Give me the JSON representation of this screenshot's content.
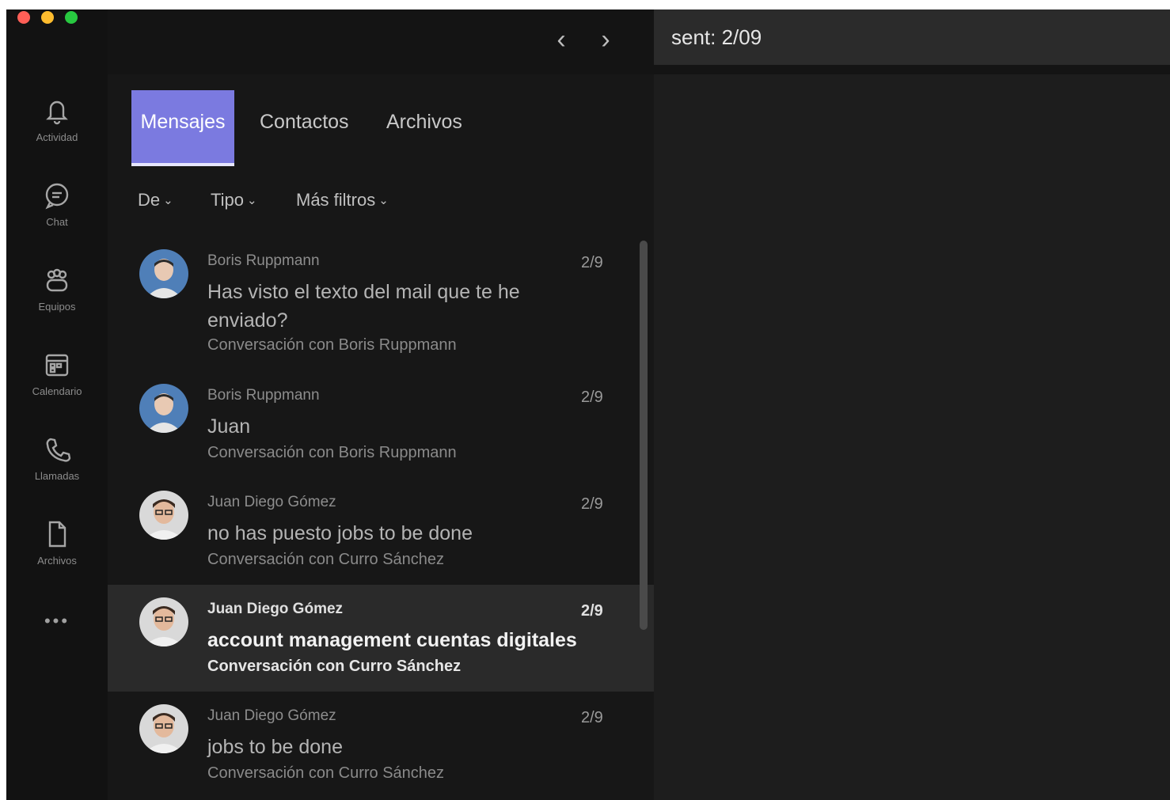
{
  "window": {
    "controls": {
      "close": "#ff5f57",
      "minimize": "#febc2e",
      "maximize": "#28c840"
    }
  },
  "rail": {
    "items": [
      {
        "label": "Actividad",
        "icon": "bell-icon"
      },
      {
        "label": "Chat",
        "icon": "chat-icon"
      },
      {
        "label": "Equipos",
        "icon": "teams-icon"
      },
      {
        "label": "Calendario",
        "icon": "calendar-icon"
      },
      {
        "label": "Llamadas",
        "icon": "phone-icon"
      },
      {
        "label": "Archivos",
        "icon": "file-icon"
      }
    ],
    "more_label": "•••"
  },
  "topbar": {
    "back_label": "‹",
    "forward_label": "›",
    "search_value": "sent: 2/09"
  },
  "tabs": [
    {
      "label": "Mensajes",
      "active": true
    },
    {
      "label": "Contactos",
      "active": false
    },
    {
      "label": "Archivos",
      "active": false
    }
  ],
  "filters": [
    {
      "label": "De"
    },
    {
      "label": "Tipo"
    },
    {
      "label": "Más filtros"
    }
  ],
  "results": [
    {
      "name": "Boris Ruppmann",
      "date": "2/9",
      "text": "Has visto el texto del mail que te he enviado?",
      "sub": "Conversación con Boris Ruppmann",
      "avatar": "blue",
      "selected": false
    },
    {
      "name": "Boris Ruppmann",
      "date": "2/9",
      "text": "Juan",
      "sub": "Conversación con Boris Ruppmann",
      "avatar": "blue",
      "selected": false
    },
    {
      "name": "Juan Diego Gómez",
      "date": "2/9",
      "text": "no has puesto jobs to be done",
      "sub": "Conversación con Curro Sánchez",
      "avatar": "light",
      "selected": false
    },
    {
      "name": "Juan Diego Gómez",
      "date": "2/9",
      "text": "account management cuentas digitales",
      "sub": "Conversación con Curro Sánchez",
      "avatar": "light",
      "selected": true
    },
    {
      "name": "Juan Diego Gómez",
      "date": "2/9",
      "text": "jobs to be done",
      "sub": "Conversación con Curro Sánchez",
      "avatar": "light",
      "selected": false
    }
  ],
  "colors": {
    "accent": "#7b7ae0",
    "background": "#1f1f1f"
  }
}
